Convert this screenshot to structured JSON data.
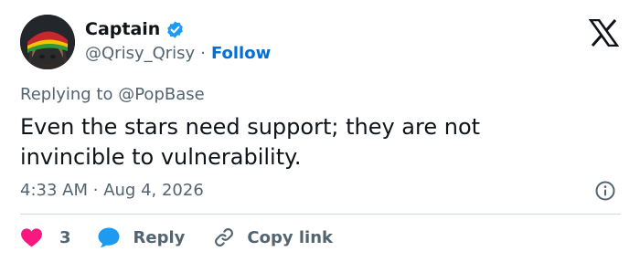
{
  "author": {
    "display_name": "Captain",
    "handle": "@Qrisy_Qrisy",
    "separator": "·",
    "follow_label": "Follow",
    "verified": true
  },
  "tweet": {
    "reply_prefix": "Replying to",
    "reply_handle": "@PopBase",
    "text": "Even the stars need support; they are not invincible to vulnerability.",
    "time": "4:33 AM",
    "separator": "·",
    "date": "Aug 4, 2026"
  },
  "actions": {
    "like_count": "3",
    "reply_label": "Reply",
    "copy_label": "Copy link"
  },
  "colors": {
    "like": "#f91880",
    "reply": "#1d9bf0",
    "follow": "#006fd6",
    "verified": "#1d9bf0",
    "secondary_text": "#536471"
  },
  "icons": [
    "verified-badge-icon",
    "x-logo-icon",
    "info-icon",
    "heart-icon",
    "reply-bubble-icon",
    "link-icon"
  ]
}
